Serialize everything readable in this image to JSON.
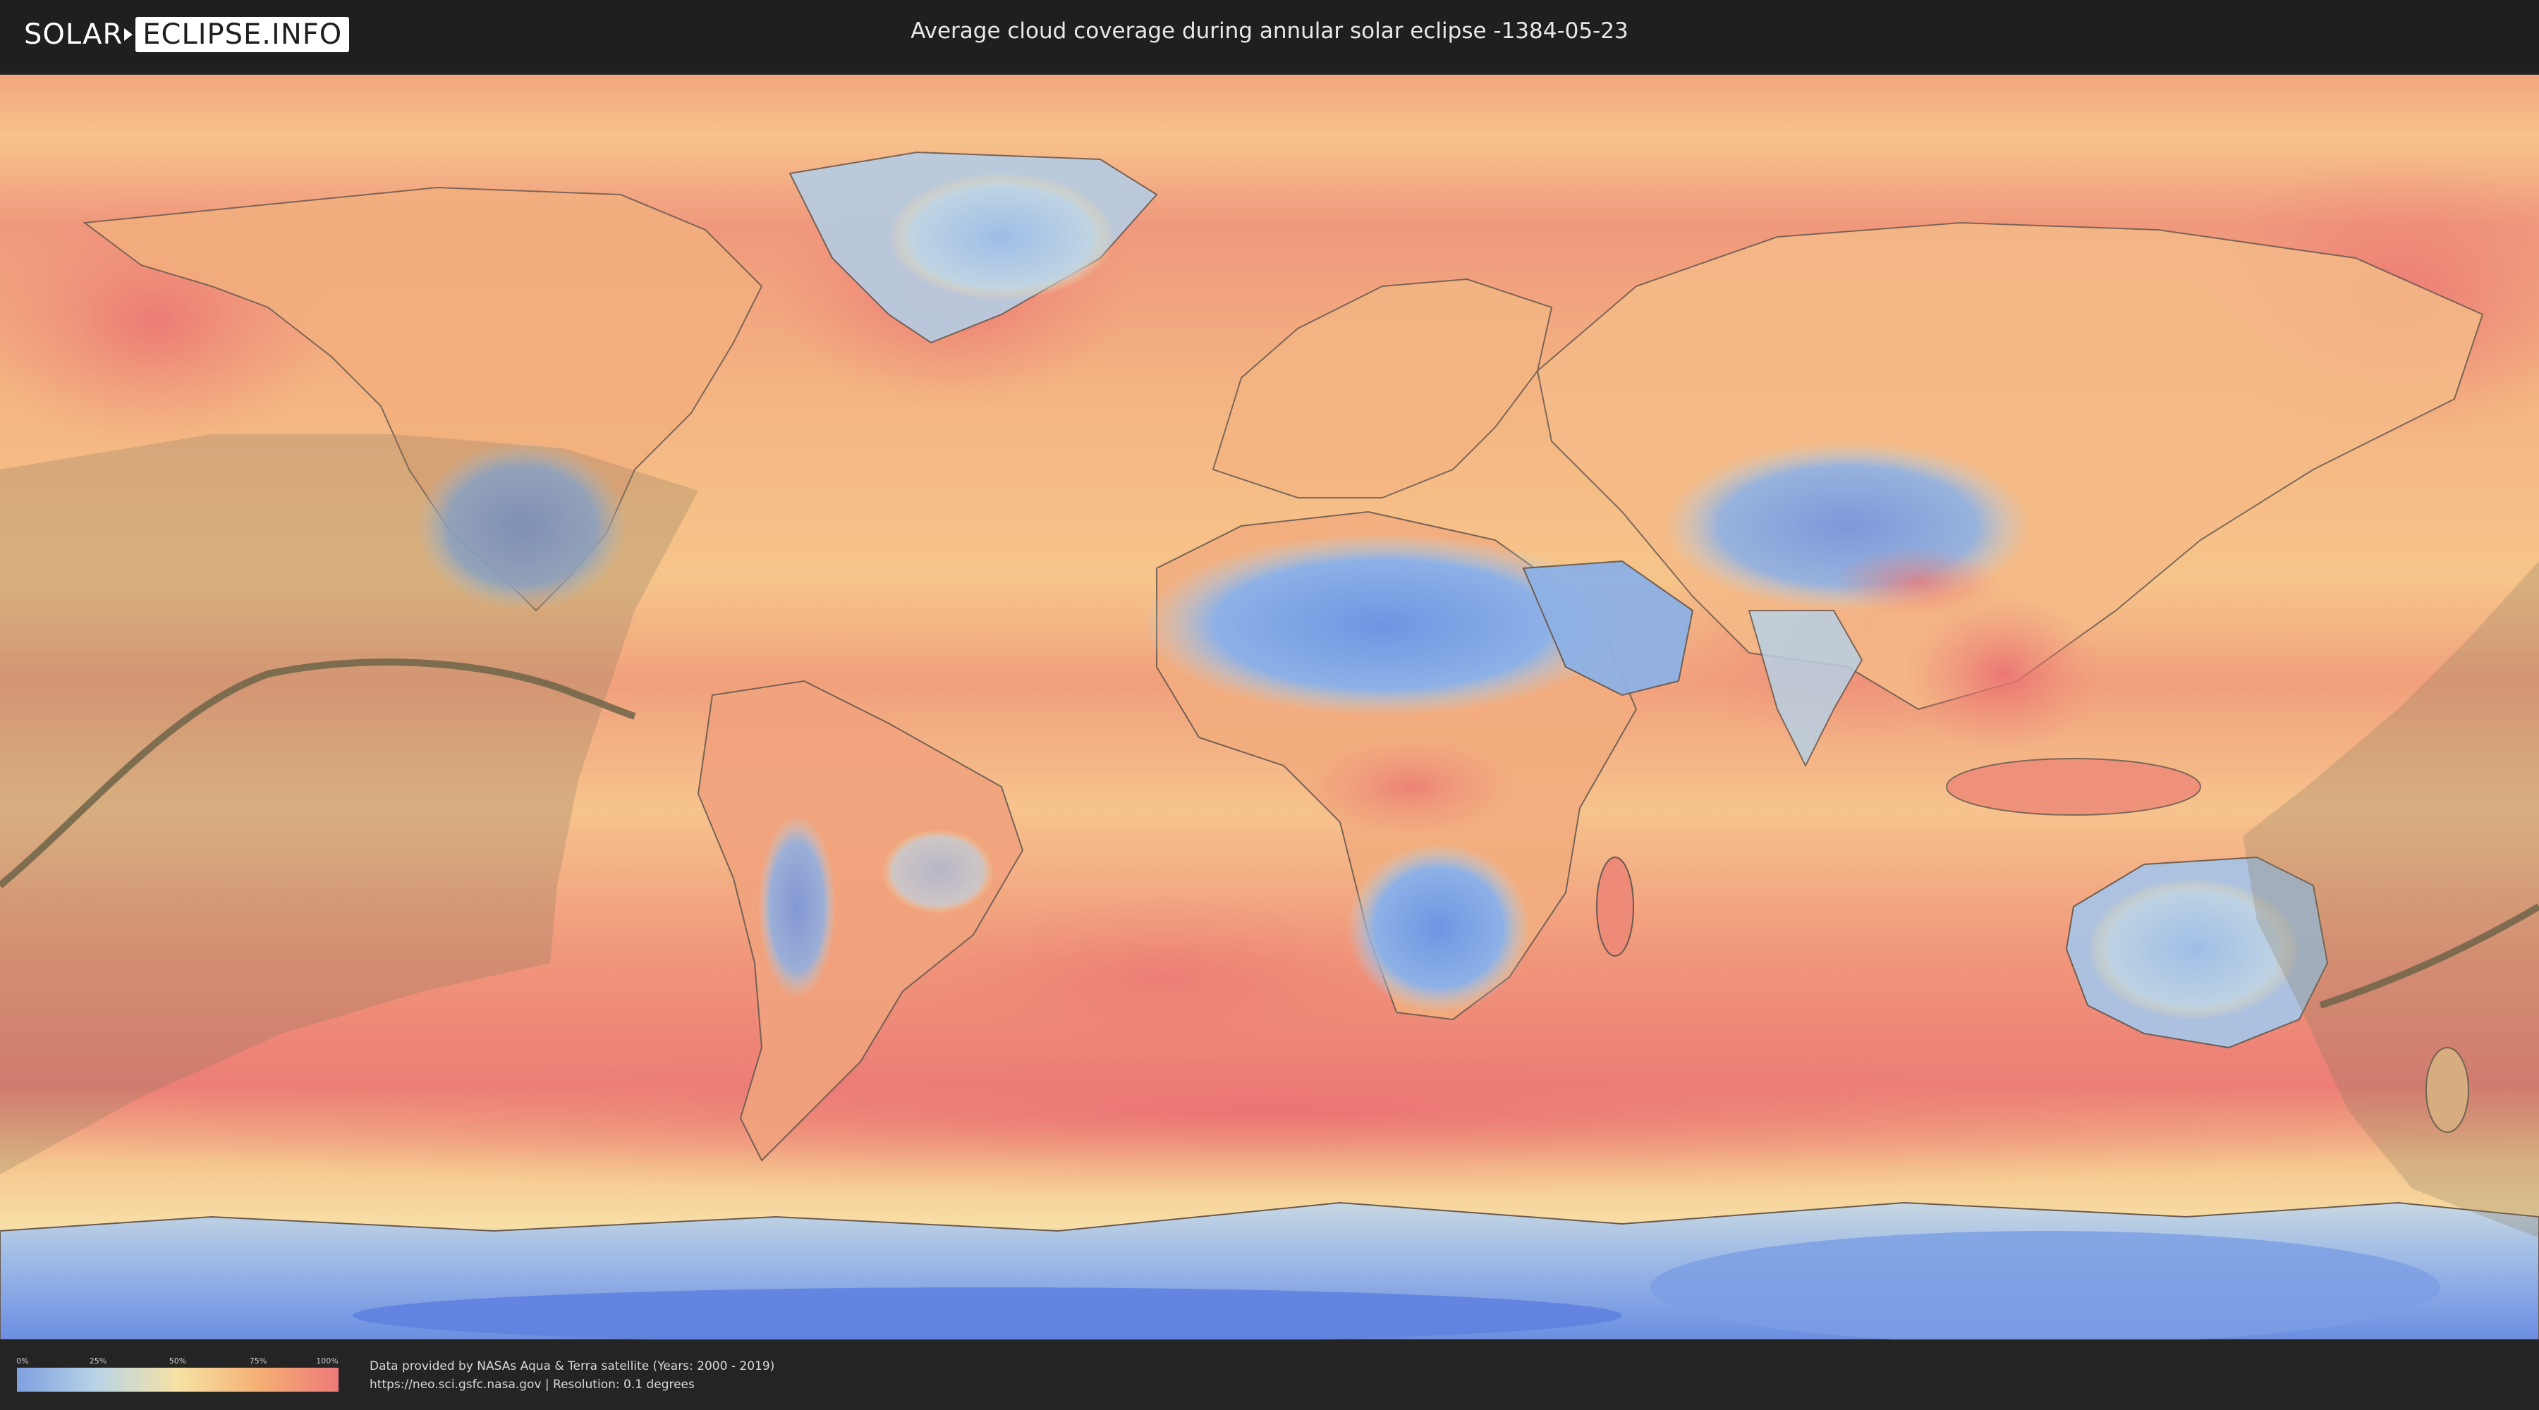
{
  "logo": {
    "part1": "SOLAR",
    "part2": "ECLIPSE.INFO"
  },
  "title": "Average cloud coverage during annular solar eclipse -1384-05-23",
  "legend": {
    "ticks": [
      "0%",
      "25%",
      "50%",
      "75%",
      "100%"
    ],
    "tick_values": [
      0,
      25,
      50,
      75,
      100
    ],
    "colors": {
      "low": "#7ea0e0",
      "mid_low": "#b9d4e6",
      "mid": "#f6e2a4",
      "mid_high": "#f5b075",
      "high": "#ee7a78"
    }
  },
  "source": {
    "line1": "Data provided by NASAs Aqua & Terra satellite (Years: 2000 - 2019)",
    "line2": "https://neo.sci.gsfc.nasa.gov | Resolution: 0.1 degrees"
  },
  "map": {
    "colors": {
      "ocean_cloudy": "#ef8a7a",
      "mid_cloud": "#f7c98f",
      "low_cloud": "#8fb3e6",
      "very_low_cloud": "#5b7ee0",
      "shadow_overlay": "#8a7a5c",
      "eclipse_path_line": "#6f6449",
      "coastline": "#6a5a50"
    }
  }
}
